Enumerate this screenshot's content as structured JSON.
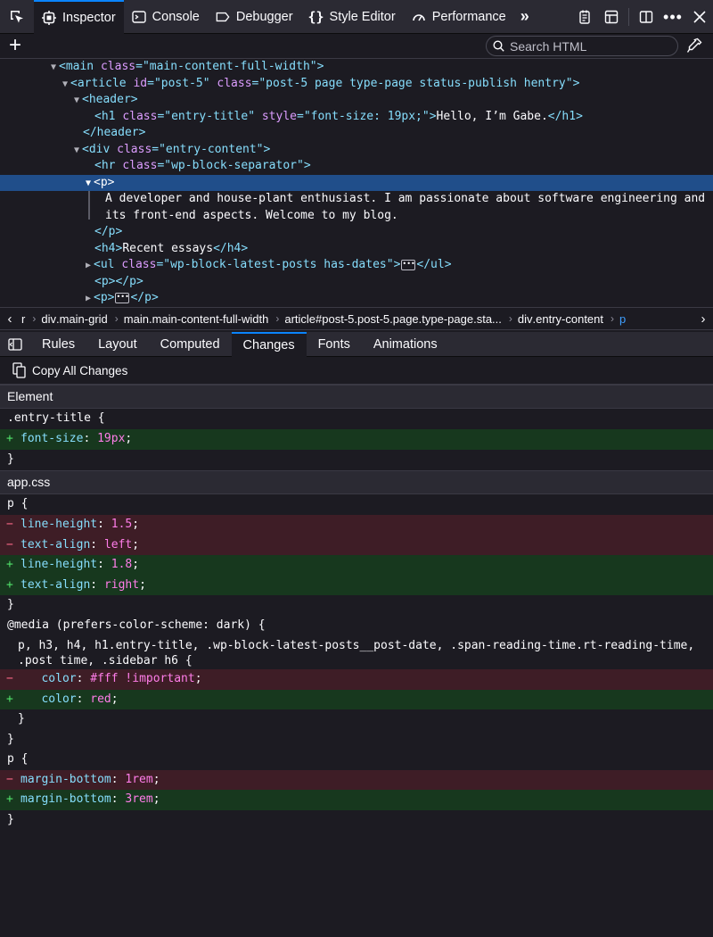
{
  "toolbar": {
    "tabs": [
      {
        "label": "Inspector",
        "icon": "inspector-icon",
        "active": true
      },
      {
        "label": "Console",
        "icon": "console-icon"
      },
      {
        "label": "Debugger",
        "icon": "debugger-icon"
      },
      {
        "label": "Style Editor",
        "icon": "style-editor-icon"
      },
      {
        "label": "Performance",
        "icon": "performance-icon"
      }
    ],
    "accent": "#0a84ff"
  },
  "search": {
    "placeholder": "Search HTML"
  },
  "markup": {
    "l1": {
      "tag_open": "<main ",
      "attr1": "class",
      "val1": "\"main-content-full-width\"",
      "tag_close": ">"
    },
    "l2": {
      "tag_open": "<article ",
      "attr1": "id",
      "val1": "\"post-5\"",
      "attr2": "class",
      "val2": "\"post-5 page type-page status-publish hentry\"",
      "tag_close": ">"
    },
    "l3": {
      "tag": "<header>"
    },
    "l4": {
      "tag_open": "<h1 ",
      "attr1": "class",
      "val1": "\"entry-title\"",
      "attr2": "style",
      "val2": "\"font-size: 19px;\"",
      "gt": ">",
      "text": "Hello, I’m Gabe.",
      "tag_end": "</h1>"
    },
    "l5": {
      "tag": "</header>"
    },
    "l6": {
      "tag_open": "<div ",
      "attr1": "class",
      "val1": "\"entry-content\"",
      "tag_close": ">"
    },
    "l7": {
      "tag_open": "<hr ",
      "attr1": "class",
      "val1": "\"wp-block-separator\"",
      "tag_close": ">"
    },
    "l8": {
      "tag": "<p>"
    },
    "l9": {
      "text": "A developer and house-plant enthusiast. I am passionate about software engineering and"
    },
    "l10": {
      "text": "its front-end aspects. Welcome to my blog."
    },
    "l11": {
      "tag": "</p>"
    },
    "l12": {
      "tag_open": "<h4>",
      "text": "Recent essays",
      "tag_end": "</h4>"
    },
    "l13": {
      "tag_open": "<ul ",
      "attr1": "class",
      "val1": "\"wp-block-latest-posts has-dates\"",
      "gt": ">",
      "tag_end": "</ul>"
    },
    "l14": {
      "tag": "<p></p>"
    },
    "l15": {
      "tag_open": "<p>",
      "tag_end": "</p>"
    }
  },
  "breadcrumbs": {
    "items": [
      {
        "tag": "r",
        "rest": ""
      },
      {
        "tag": "div",
        "rest": ".main-grid"
      },
      {
        "tag": "main",
        "rest": ".main-content-full-width"
      },
      {
        "tag": "article",
        "rest": "#post-5.post-5.page.type-page.sta..."
      },
      {
        "tag": "div",
        "rest": ".entry-content"
      },
      {
        "tag": "p",
        "rest": ""
      }
    ]
  },
  "panel_tabs": [
    {
      "label": "Rules"
    },
    {
      "label": "Layout"
    },
    {
      "label": "Computed"
    },
    {
      "label": "Changes",
      "active": true
    },
    {
      "label": "Fonts"
    },
    {
      "label": "Animations"
    }
  ],
  "changes": {
    "copy_all": "Copy All Changes",
    "section1": "Element",
    "s1_selector": ".entry-title {",
    "s1_add": {
      "prop": "font-size",
      "val": "19px"
    },
    "brace": "}",
    "section2": "app.css",
    "s2_selector": "p {",
    "s2_rem1": {
      "prop": "line-height",
      "val": "1.5"
    },
    "s2_rem2": {
      "prop": "text-align",
      "val": "left"
    },
    "s2_add1": {
      "prop": "line-height",
      "val": "1.8"
    },
    "s2_add2": {
      "prop": "text-align",
      "val": "right"
    },
    "media": "@media (prefers-color-scheme: dark) {",
    "media_sel_1": "p, h3, h4, h1.entry-title, .wp-block-latest-posts__post-date, .span-reading-time.rt-reading-time,",
    "media_sel_2": ".post time, .sidebar h6 {",
    "media_rem": {
      "prop": "color",
      "val": "#fff !important"
    },
    "media_add": {
      "prop": "color",
      "val": "red"
    },
    "s3_selector": "p {",
    "s3_rem": {
      "prop": "margin-bottom",
      "val": "1rem"
    },
    "s3_add": {
      "prop": "margin-bottom",
      "val": "3rem"
    },
    "plus": "+",
    "minus": "−",
    "colors": {
      "added_bg": "#17381e",
      "removed_bg": "#3e1d26"
    }
  }
}
